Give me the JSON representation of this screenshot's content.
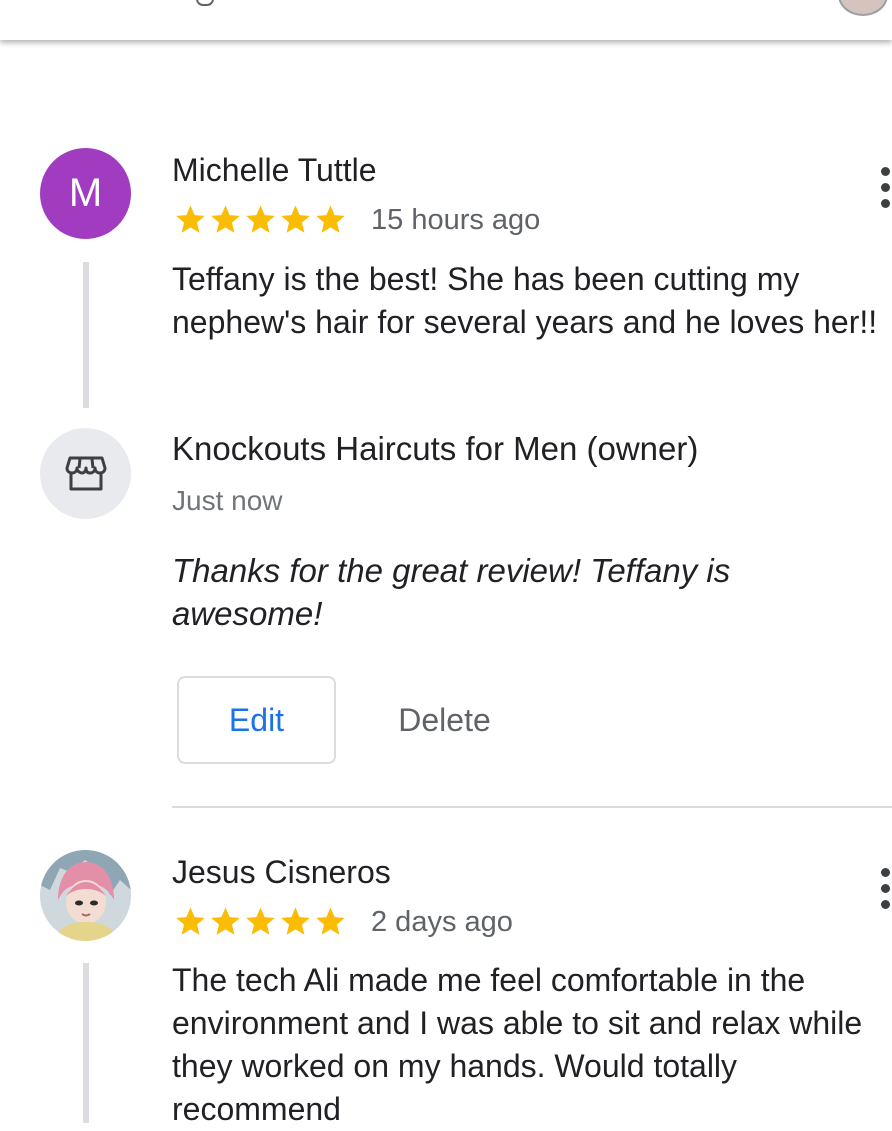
{
  "colors": {
    "star": "#fbbc04",
    "accent_blue": "#1a73e8",
    "avatar_purple": "#a13cc0",
    "divider": "#dadce0"
  },
  "reviews": [
    {
      "avatar_letter": "M",
      "name": "Michelle Tuttle",
      "rating": 5,
      "time": "15 hours ago",
      "text": "Teffany is the best! She has been cutting my nephew's hair for several years and he loves her!!",
      "owner_reply": {
        "name": "Knockouts Haircuts for Men (owner)",
        "time": "Just now",
        "text": "Thanks for the great review! Teffany is awesome!",
        "icon": "storefront-icon"
      },
      "actions": {
        "edit_label": "Edit",
        "delete_label": "Delete"
      }
    },
    {
      "avatar_icon": "user-photo-avatar",
      "name": "Jesus Cisneros",
      "rating": 5,
      "time": "2 days ago",
      "text": "The tech Ali made me feel comfortable in the environment and I was able to sit and relax while they worked on my hands. Would totally recommend"
    }
  ]
}
